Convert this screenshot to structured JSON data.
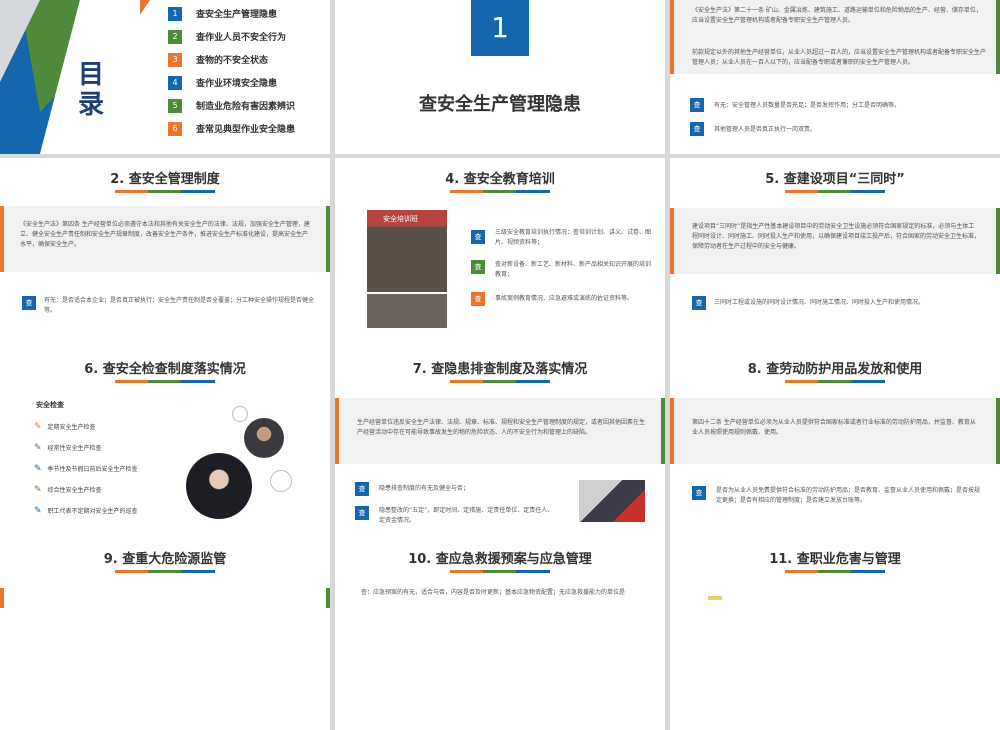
{
  "toc": {
    "heading_line1": "目",
    "heading_line2": "录",
    "items": [
      {
        "num": "1",
        "label": "查安全生产管理隐患",
        "color": "#1666ad"
      },
      {
        "num": "2",
        "label": "查作业人员不安全行为",
        "color": "#4f8a3a"
      },
      {
        "num": "3",
        "label": "查物的不安全状态",
        "color": "#e8762d"
      },
      {
        "num": "4",
        "label": "查作业环境安全隐患",
        "color": "#1666ad"
      },
      {
        "num": "5",
        "label": "制造业危险有害因素辨识",
        "color": "#4f8a3a"
      },
      {
        "num": "6",
        "label": "查常见典型作业安全隐患",
        "color": "#e8762d"
      }
    ]
  },
  "section1": {
    "num": "1",
    "title": "查安全生产管理隐患"
  },
  "law_slide": {
    "para1": "《安全生产法》第二十一条 矿山、金属冶炼、建筑施工、道路运输单位和危险物品的生产、经营、储存单位，应当设置安全生产管理机构或者配备专职安全生产管理人员。",
    "para2": "前款规定以外的其他生产经营单位，从业人员超过一百人的，应当设置安全生产管理机构或者配备专职安全生产管理人员；从业人员在一百人以下的，应当配备专职或者兼职的安全生产管理人员。",
    "items": [
      {
        "chip": "查",
        "text": "有无：安全管理人员数量是否充足；是否发挥作用；分工是否明确等。"
      },
      {
        "chip": "查",
        "text": "其他管理人员是否真正执行一岗双责。"
      }
    ]
  },
  "slide2": {
    "title": "2. 查安全管理制度",
    "body": "《安全生产法》第四条 生产经营单位必须遵守本法和其他有关安全生产的法律、法规，加强安全生产管理，建立、健全安全生产责任制和安全生产规章制度，改善安全生产条件，推进安全生产标准化建设，提高安全生产水平，确保安全生产。",
    "chip": "查",
    "check": "有无：是否适合本企业；是否真正被执行；安全生产责任制是否全覆盖；分工种安全操作规程是否健全等。"
  },
  "slide4": {
    "title": "4. 查安全教育培训",
    "photo_text": "安全培训班",
    "items": [
      {
        "chip": "查",
        "text": "三级安全教育培训执行情况：查培训计划、讲义、试卷、图片、视频资料等；"
      },
      {
        "chip": "查",
        "text": "查对新设备、新工艺、新材料、新产品相关知识开展的培训教育；"
      },
      {
        "chip": "查",
        "text": "事故案例教育情况、应急避难或演练的佐证资料等。"
      }
    ]
  },
  "slide5": {
    "title": "5. 查建设项目“三同时”",
    "body": "建设项目“三同时”是指生产性基本建设项目中的劳动安全卫生设施必须符合国家规定的标准，必须与主体工程同时设计、同时施工、同时投入生产和使用，以确保建设项目竣工投产后，符合国家的劳动安全卫生标准，保障劳动者在生产过程中的安全与健康。",
    "chip": "查",
    "check": "三同时工程或设施的同时设计情况、同时施工情况、同时投入生产和使用情况。"
  },
  "slide6": {
    "title": "6. 查安全检查制度落实情况",
    "subtitle": "安全检查",
    "items": [
      "定期安全生产检查",
      "经常性安全生产检查",
      "季节性及节假日前后安全生产检查",
      "综合性安全生产检查",
      "职工代表不定期对安全生产的巡查"
    ]
  },
  "slide7": {
    "title": "7. 查隐患排查制度及落实情况",
    "body": "生产经营单位违反安全生产法律、法规、规章、标准、规程和安全生产管理制度的规定，或者因其他因素在生产经营活动中存在可能导致事故发生的物的危险状态、人的不安全行为和管理上的缺陷。",
    "items": [
      {
        "chip": "查",
        "text": "隐患排查制度的有无及健全与否；"
      },
      {
        "chip": "查",
        "text": "隐患整改的“五定”，即定时间、定措施、定责任单位、定责任人、定资金情况。"
      }
    ]
  },
  "slide8": {
    "title": "8. 查劳动防护用品发放和使用",
    "body": "第四十二条 生产经营单位必须为从业人员提供符合国家标准或者行业标准的劳动防护用品，并监督、教育从业人员按照使用规则佩戴、使用。",
    "chip": "查",
    "check": "是否为从业人员免费提供符合标准的劳动防护用品；是否教育、监督从业人员使用和佩戴；是否按规定更换；是否有相应的管理制度；是否建立发放台账等。"
  },
  "slide9": {
    "title": "9. 查重大危险源监管"
  },
  "slide10": {
    "title": "10. 查应急救援预案与应急管理",
    "body": "查：应急预案的有无，适合与否，内容是否及时更新；基本应急物资配置；无应急救援能力的单位是"
  },
  "slide11": {
    "title": "11. 查职业危害与管理"
  },
  "colors": {
    "blue": "#1666ad",
    "green": "#4f8a3a",
    "orange": "#e8762d"
  }
}
